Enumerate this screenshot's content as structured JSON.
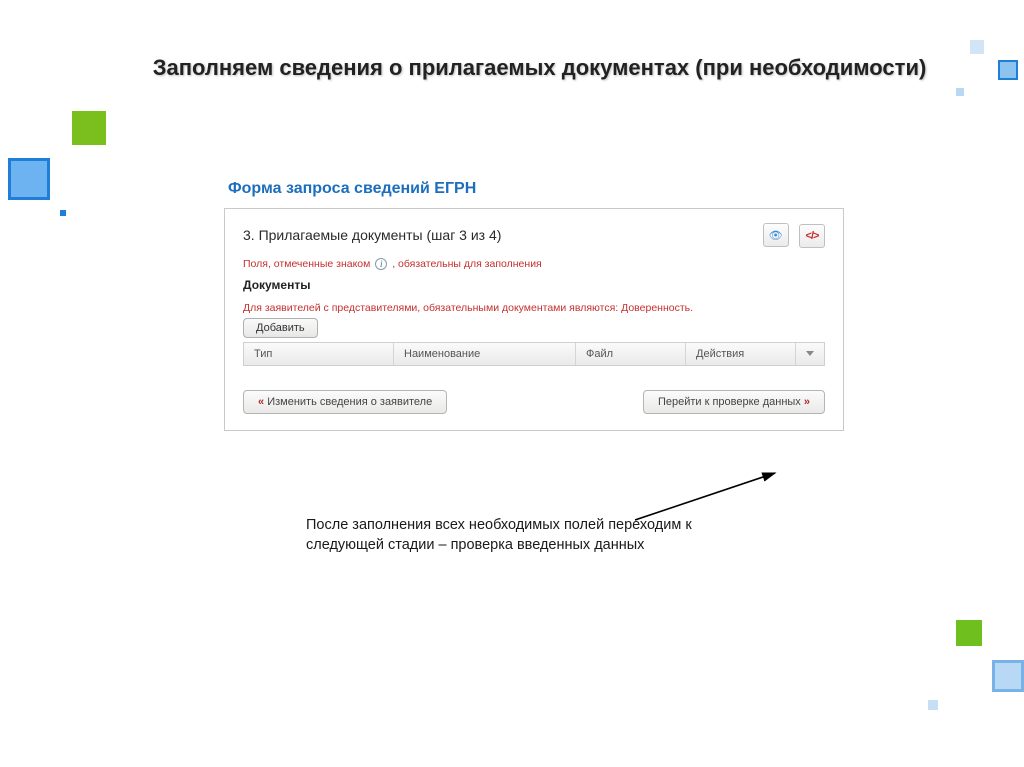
{
  "slide": {
    "title": "Заполняем сведения о прилагаемых документах (при необходимости)"
  },
  "form": {
    "title": "Форма запроса сведений ЕГРН",
    "step_title": "3. Прилагаемые документы (шаг 3 из 4)",
    "required_note_pre": "Поля, отмеченные знаком",
    "required_note_post": ", обязательны для заполнения",
    "section_label": "Документы",
    "rep_note": "Для заявителей с представителями, обязательными документами являются: Доверенность.",
    "add_button": "Добавить",
    "columns": {
      "type": "Тип",
      "name": "Наименование",
      "file": "Файл",
      "actions": "Действия"
    },
    "back_button": "Изменить сведения о заявителе",
    "next_button": "Перейти к проверке данных"
  },
  "caption": "После заполнения всех необходимых полей переходим к следующей стадии – проверка введенных данных",
  "icons": {
    "eye": "👁",
    "xml": "</>",
    "quote_left": "«",
    "quote_right": "»",
    "info": "i"
  }
}
